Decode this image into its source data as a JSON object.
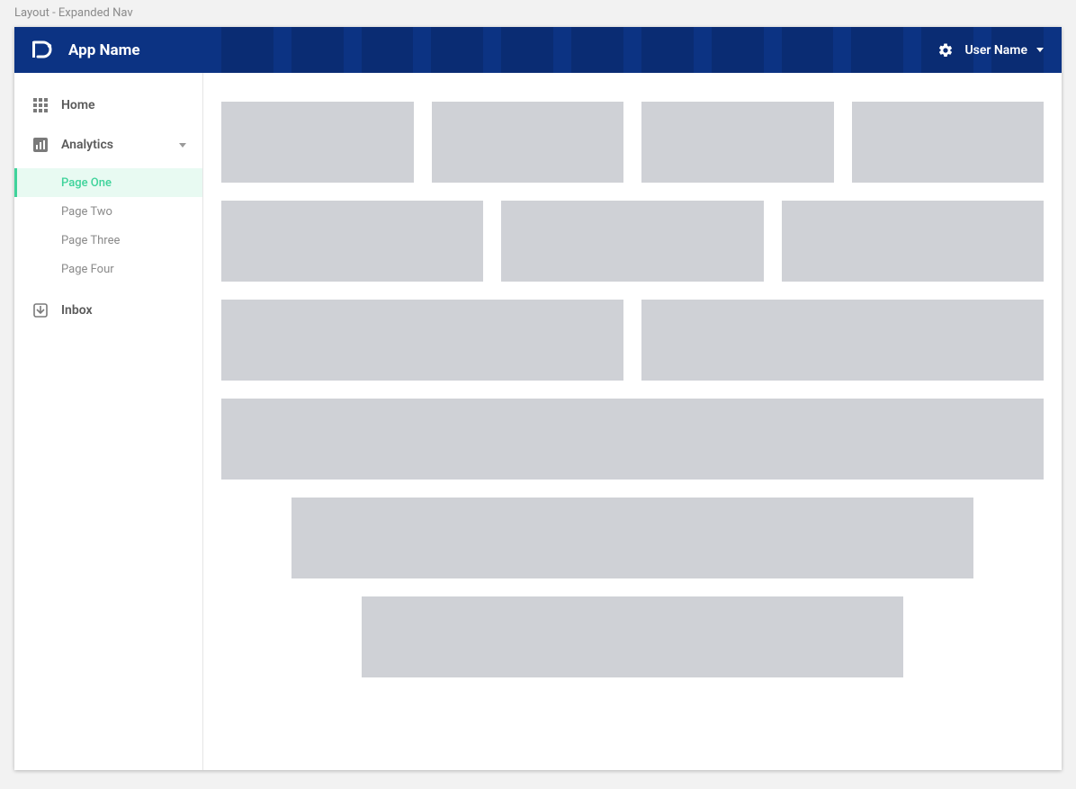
{
  "page_label": "Layout - Expanded Nav",
  "header": {
    "app_name": "App Name",
    "user_name": "User Name"
  },
  "sidebar": {
    "home_label": "Home",
    "analytics_label": "Analytics",
    "inbox_label": "Inbox",
    "subpages": [
      {
        "label": "Page One",
        "active": true
      },
      {
        "label": "Page Two",
        "active": false
      },
      {
        "label": "Page Three",
        "active": false
      },
      {
        "label": "Page Four",
        "active": false
      }
    ]
  },
  "colors": {
    "header_bg": "#0c3383",
    "accent": "#3fd39b",
    "grid_col": "#e6e8ee",
    "block": "#cfd1d6"
  }
}
